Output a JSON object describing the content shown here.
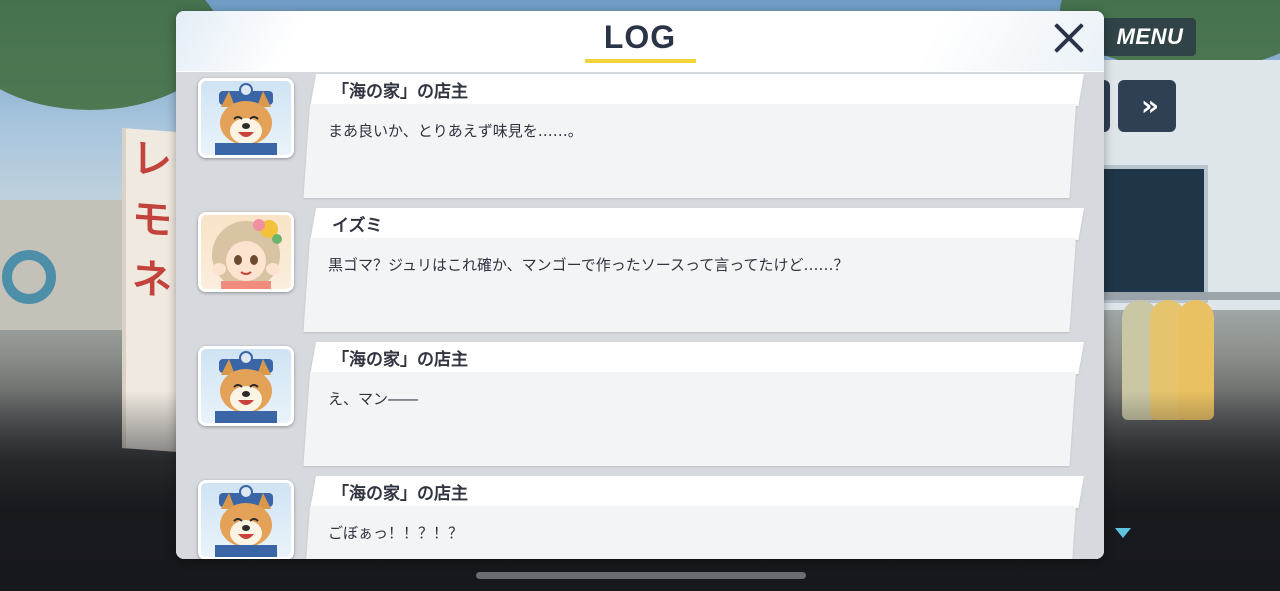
{
  "ui": {
    "menu_label": "MENU",
    "fast_forward_label": "»",
    "log_title": "LOG"
  },
  "log": {
    "entries": [
      {
        "speaker": "「海の家」の店主",
        "avatar": "shiba-dog-avatar",
        "text": "まあ良いか、とりあえず味見を……。"
      },
      {
        "speaker": "イズミ",
        "avatar": "girl-avatar",
        "text": "黒ゴマ？ジュリはこれ確か、マンゴーで作ったソースって言ってたけど……？"
      },
      {
        "speaker": "「海の家」の店主",
        "avatar": "shiba-dog-avatar",
        "text": "え、マン――"
      },
      {
        "speaker": "「海の家」の店主",
        "avatar": "shiba-dog-avatar",
        "text": "ごぼぁっ！！？！？"
      }
    ]
  },
  "colors": {
    "accent_underline": "#f0d43b",
    "title_text": "#2a3347",
    "scroll_arrow": "#5fc3e0"
  }
}
